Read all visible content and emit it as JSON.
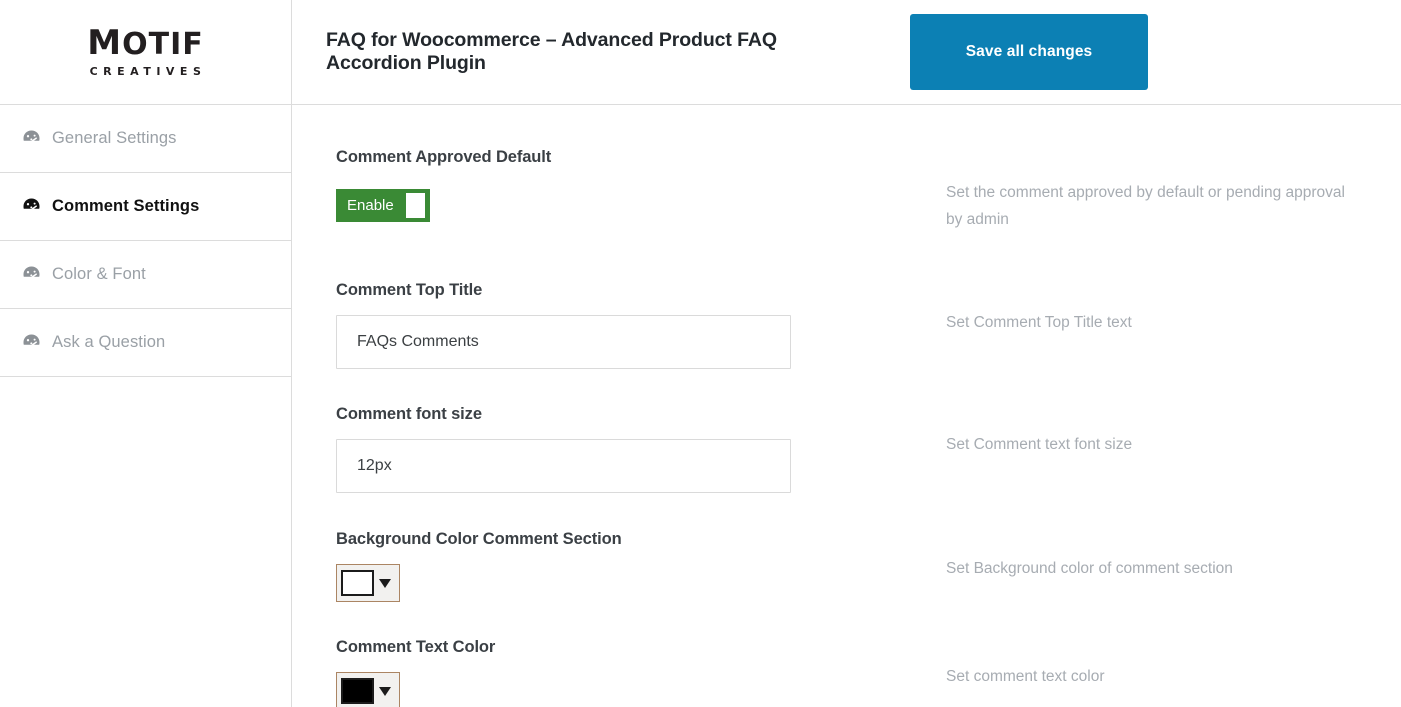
{
  "brand": {
    "name_lead": "M",
    "name_rest": "OTIF",
    "tagline": "CREATIVES"
  },
  "sidebar": {
    "items": [
      {
        "label": "General Settings",
        "icon": "palette-icon",
        "active": false
      },
      {
        "label": "Comment Settings",
        "icon": "palette-icon",
        "active": true
      },
      {
        "label": "Color & Font",
        "icon": "palette-icon",
        "active": false
      },
      {
        "label": "Ask a Question",
        "icon": "palette-icon",
        "active": false
      }
    ]
  },
  "header": {
    "title": "FAQ for Woocommerce – Advanced Product FAQ Accordion Plugin",
    "save_label": "Save all changes",
    "save_color": "#0c80b4"
  },
  "fields": {
    "comment_approved": {
      "label": "Comment Approved Default",
      "toggle_label": "Enable",
      "toggle_state": "on",
      "toggle_color": "#3a8a35",
      "description": "Set the comment approved by default or pending approval by admin"
    },
    "comment_top_title": {
      "label": "Comment Top Title",
      "value": "FAQs Comments",
      "placeholder": "Comment Top Title",
      "description": "Set Comment Top Title text"
    },
    "comment_font_size": {
      "label": "Comment font size",
      "value": "12px",
      "placeholder": "Comment font size",
      "description": "Set Comment text font size"
    },
    "background_color": {
      "label": "Background Color Comment Section",
      "value": "#ffffff",
      "description": "Set Background color of comment section"
    },
    "text_color": {
      "label": "Comment Text Color",
      "value": "#000000",
      "description": "Set comment text color"
    }
  }
}
